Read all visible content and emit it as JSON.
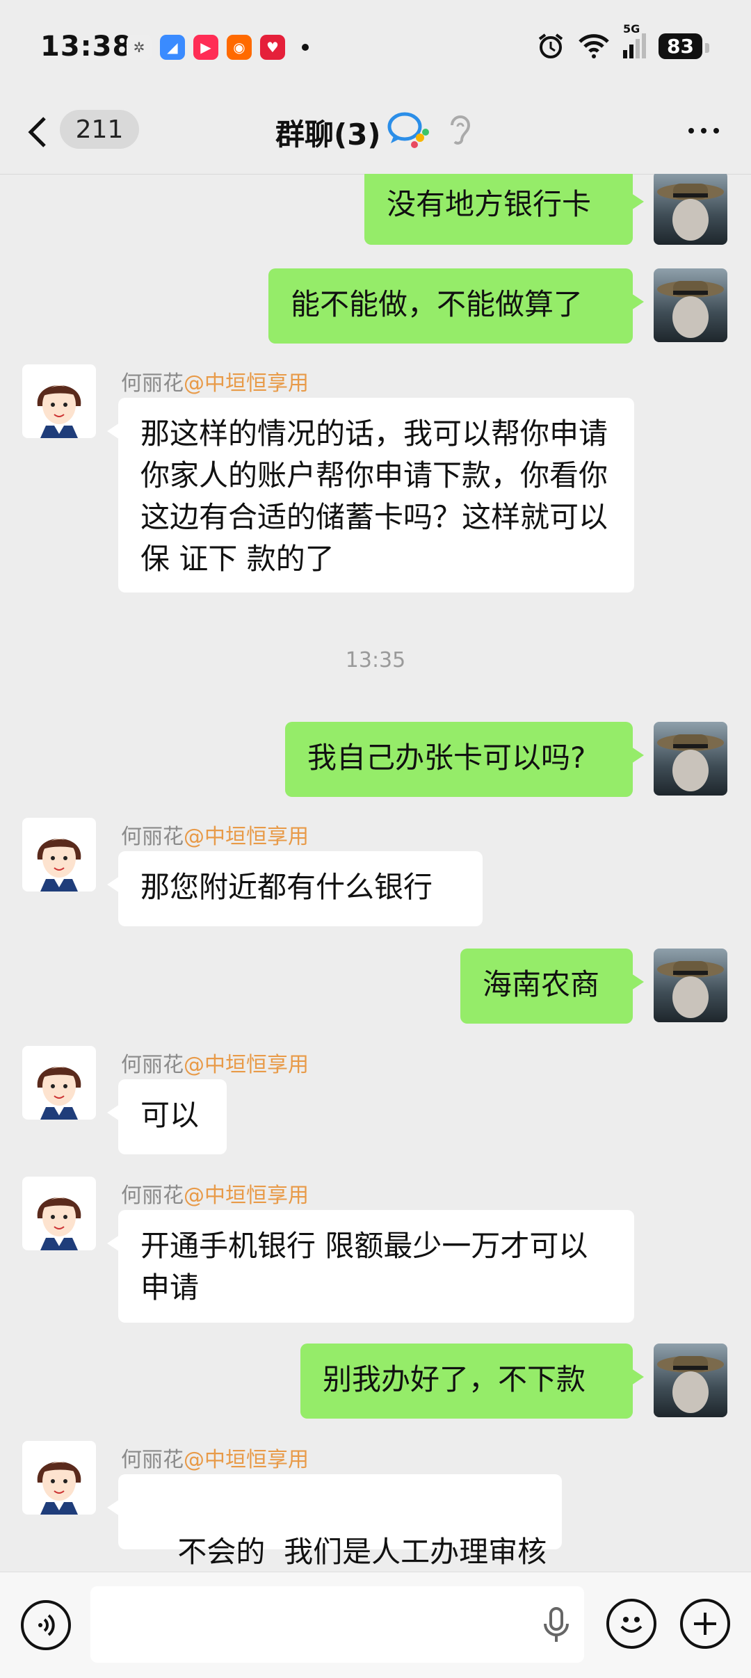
{
  "status": {
    "time": "13:38",
    "network": "5G",
    "battery": "83"
  },
  "header": {
    "unread_count": "211",
    "title": "群聊(3)"
  },
  "messages": {
    "m1": {
      "text": "没有地方银行卡"
    },
    "m2": {
      "text": "能不能做，不能做算了"
    },
    "m3": {
      "name": "何丽花",
      "tag": "@中垣恒享用",
      "text": "那这样的情况的话，我可以帮你申请你家人的账户帮你申请下款，你看你这边有合适的储蓄卡吗？这样就可以保 证下 款的了"
    },
    "ts1": "13:35",
    "m4": {
      "text": "我自己办张卡可以吗?"
    },
    "m5": {
      "name": "何丽花",
      "tag": "@中垣恒享用",
      "text": "那您附近都有什么银行"
    },
    "m6": {
      "text": "海南农商"
    },
    "m7": {
      "name": "何丽花",
      "tag": "@中垣恒享用",
      "text": "可以"
    },
    "m8": {
      "name": "何丽花",
      "tag": "@中垣恒享用",
      "text": "开通手机银行 限额最少一万才可以申请"
    },
    "m9": {
      "text": "别我办好了，不下款"
    },
    "m10": {
      "name": "何丽花",
      "tag": "@中垣恒享用",
      "text": "不会的  我们是人工办理审核"
    }
  },
  "input": {
    "value": "",
    "placeholder": ""
  },
  "colors": {
    "my_bubble": "#95ec69",
    "other_bubble": "#ffffff",
    "background": "#ededed",
    "sender_tag": "#e89a48"
  },
  "icons": [
    "back-arrow-icon",
    "group-chat-icon",
    "ear-icon",
    "more-icon",
    "voice-toggle-icon",
    "microphone-icon",
    "emoji-icon",
    "plus-icon"
  ]
}
